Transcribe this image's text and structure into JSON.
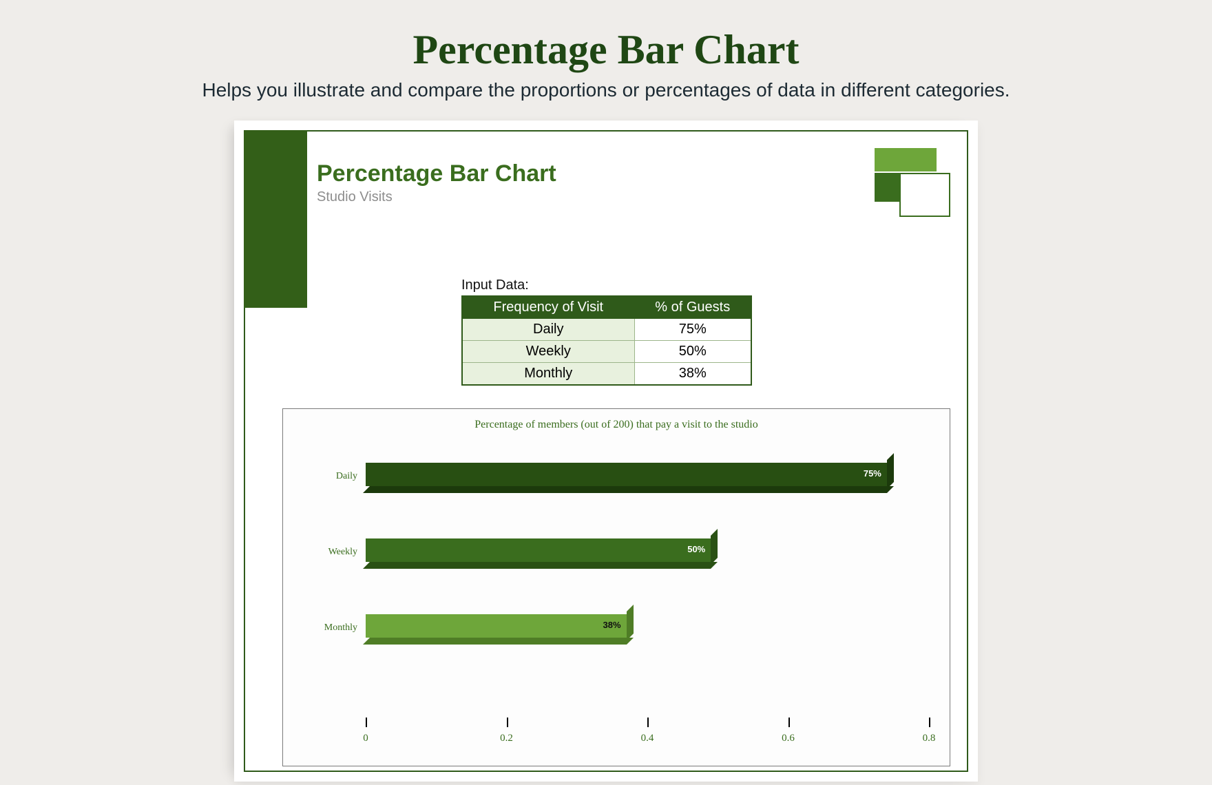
{
  "header": {
    "title": "Percentage Bar Chart",
    "subtitle": "Helps you illustrate and compare the proportions or percentages of data in different categories."
  },
  "document": {
    "title": "Percentage Bar Chart",
    "subtitle": "Studio Visits",
    "input_label": "Input Data:",
    "table": {
      "col_frequency": "Frequency of Visit",
      "col_percent": "% of Guests",
      "rows": [
        {
          "frequency": "Daily",
          "percent_label": "75%"
        },
        {
          "frequency": "Weekly",
          "percent_label": "50%"
        },
        {
          "frequency": "Monthly",
          "percent_label": "38%"
        }
      ]
    }
  },
  "chart_data": {
    "type": "bar",
    "orientation": "horizontal",
    "title": "Percentage of members (out of 200) that pay a visit to the studio",
    "categories": [
      "Daily",
      "Weekly",
      "Monthly"
    ],
    "values": [
      0.75,
      0.5,
      0.38
    ],
    "value_labels": [
      "75%",
      "50%",
      "38%"
    ],
    "xlabel": "",
    "ylabel": "",
    "xlim": [
      0,
      0.8
    ],
    "x_ticks": [
      0,
      0.2,
      0.4,
      0.6,
      0.8
    ],
    "x_tick_labels": [
      "0",
      "0.2",
      "0.4",
      "0.6",
      "0.8"
    ],
    "colors": {
      "Daily": {
        "face": "#284f12",
        "side": "#1c3a0c",
        "floor": "#1c3a0c"
      },
      "Weekly": {
        "face": "#3a6d1e",
        "side": "#2a5114",
        "floor": "#2a5114"
      },
      "Monthly": {
        "face": "#6ea63a",
        "side": "#4f7d26",
        "floor": "#4f7d26"
      }
    }
  }
}
